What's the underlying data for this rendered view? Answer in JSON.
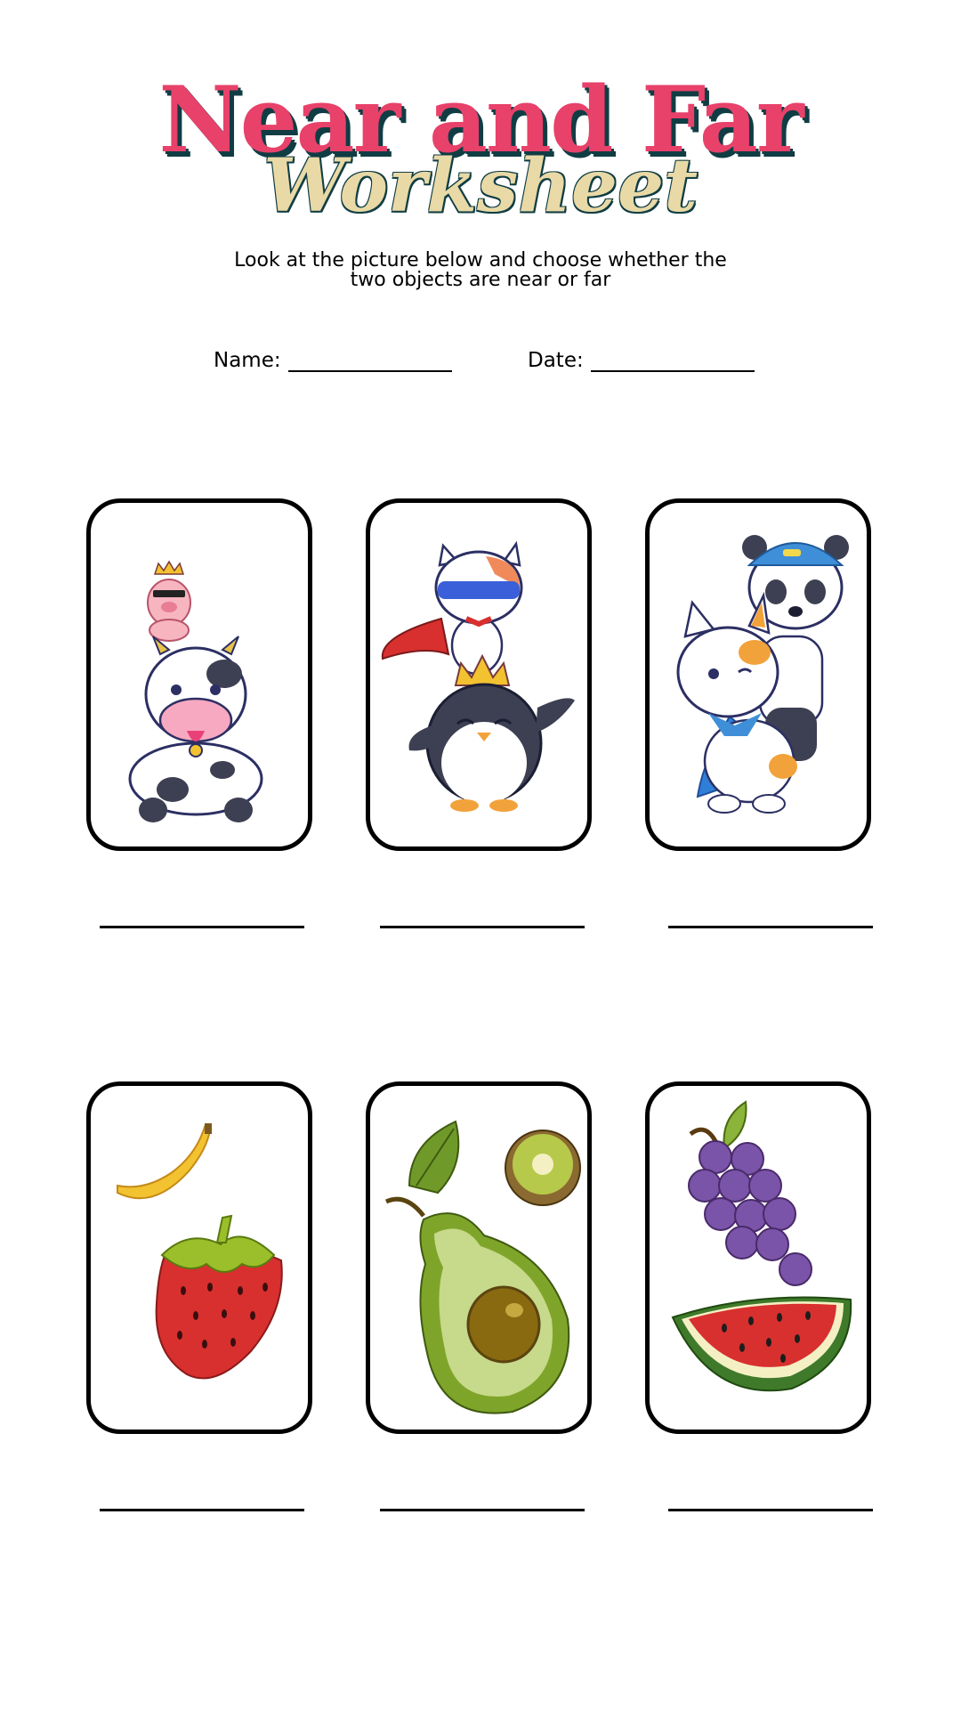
{
  "header": {
    "title": "Near and Far",
    "subtitle": "Worksheet",
    "instructions": "Look at the picture below and choose whether the two objects are near or far"
  },
  "fields": {
    "name_label": "Name:",
    "date_label": "Date:"
  },
  "cards": [
    {
      "items": [
        "pig-with-crown-icon",
        "cow-icon"
      ]
    },
    {
      "items": [
        "superhero-cat-icon",
        "penguin-with-crown-icon"
      ]
    },
    {
      "items": [
        "panda-with-cap-icon",
        "superhero-cat-icon"
      ]
    },
    {
      "items": [
        "banana-icon",
        "strawberry-icon"
      ]
    },
    {
      "items": [
        "leaf-icon",
        "kiwi-icon",
        "avocado-icon"
      ]
    },
    {
      "items": [
        "grapes-icon",
        "watermelon-icon"
      ]
    }
  ],
  "colors": {
    "title": "#e8416a",
    "title_shadow": "#103d44",
    "subtitle": "#e8d9a6"
  }
}
